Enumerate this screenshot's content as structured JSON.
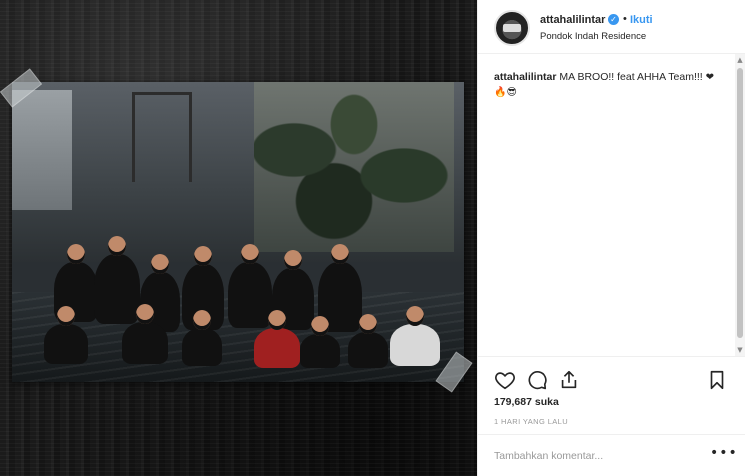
{
  "post": {
    "username": "attahalilintar",
    "follow_label": "Ikuti",
    "location": "Pondok Indah Residence",
    "caption_user": "attahalilintar",
    "caption_text": "MA BROO!! feat AHHA Team!!!",
    "caption_emojis": "❤🔥😎",
    "likes": "179,687 suka",
    "time": "1 HARI YANG LALU",
    "comment_placeholder": "Tambahkan komentar...",
    "more_label": "•••"
  },
  "icons": [
    "heart-icon",
    "comment-icon",
    "share-icon",
    "bookmark-icon",
    "verified-badge-icon"
  ],
  "colors": {
    "accent": "#3897f0",
    "text": "#262626",
    "muted": "#999999",
    "border": "#efefef"
  }
}
